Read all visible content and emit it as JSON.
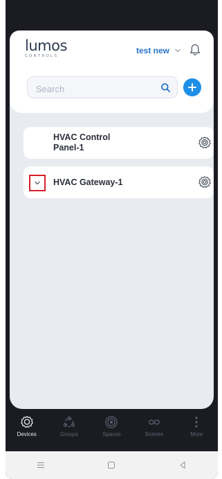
{
  "app": {
    "logo_text": "lumos",
    "logo_subtext": "CONTROLS"
  },
  "header": {
    "account_name": "test new"
  },
  "search": {
    "placeholder": "Search"
  },
  "devices": [
    {
      "name": "HVAC Control Panel-1",
      "expanded": false
    },
    {
      "name": "HVAC Gateway-1",
      "expanded": false,
      "has_expand_toggle": true
    }
  ],
  "tabbar": {
    "items": [
      {
        "label": "Devices",
        "icon": "devices-icon",
        "active": true
      },
      {
        "label": "Groups",
        "icon": "groups-icon",
        "active": false
      },
      {
        "label": "Spaces",
        "icon": "spaces-icon",
        "active": false
      },
      {
        "label": "Scenes",
        "icon": "scenes-icon",
        "active": false
      },
      {
        "label": "More",
        "icon": "more-icon",
        "active": false
      }
    ]
  },
  "system_nav": [
    "menu-icon",
    "home-icon",
    "back-icon"
  ],
  "colors": {
    "accent": "#1e8fe6",
    "account_text": "#2873c9",
    "highlight_border": "#d6202a",
    "background": "#e8ebf0",
    "tabbar": "#1b1c22"
  }
}
